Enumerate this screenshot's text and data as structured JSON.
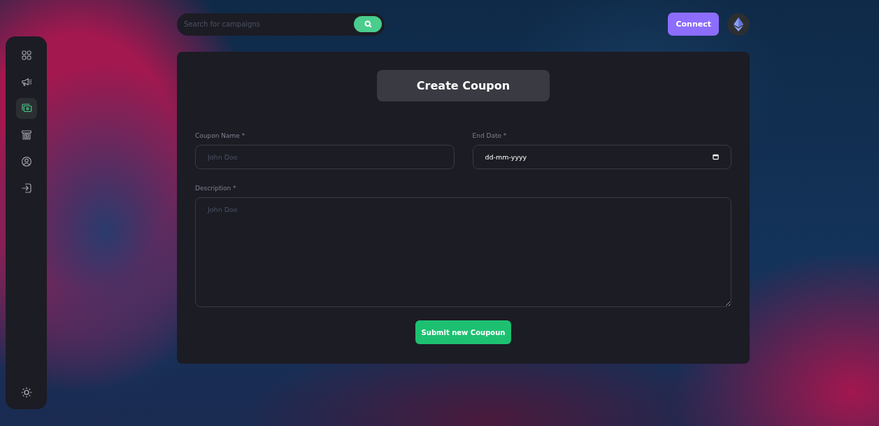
{
  "sidebar": {
    "items": [
      {
        "selected": false
      },
      {
        "selected": false
      },
      {
        "selected": true
      },
      {
        "selected": false
      },
      {
        "selected": false
      },
      {
        "selected": false
      }
    ]
  },
  "search": {
    "placeholder": "Search for campaigns"
  },
  "connect_button": "Connect",
  "form": {
    "title": "Create Coupon",
    "fields": [
      {
        "kind": "text",
        "label": "Coupon Name *",
        "placeholder": "John Doe"
      },
      {
        "kind": "date",
        "label": "End Date *",
        "value": "dd-mm-yyyy"
      },
      {
        "kind": "textarea",
        "label": "Description *",
        "placeholder": "John Doe"
      }
    ],
    "submit": "Submit new Coupoun"
  }
}
